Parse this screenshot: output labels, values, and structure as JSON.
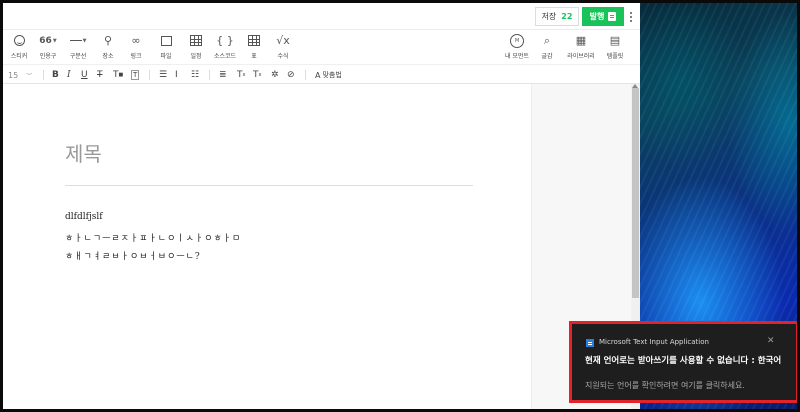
{
  "topbar": {
    "save_label": "저장",
    "save_count": "22",
    "publish_label": "발행"
  },
  "toolbar": {
    "items": [
      {
        "label": "스티커",
        "icon": "sticker-icon"
      },
      {
        "label": "인용구",
        "icon": "quote-icon",
        "glyph": "66"
      },
      {
        "label": "구분선",
        "icon": "divider-icon"
      },
      {
        "label": "장소",
        "icon": "place-icon",
        "glyph": "⚲"
      },
      {
        "label": "링크",
        "icon": "link-icon",
        "glyph": "∞"
      },
      {
        "label": "파일",
        "icon": "file-icon",
        "glyph": "+"
      },
      {
        "label": "일정",
        "icon": "schedule-icon"
      },
      {
        "label": "소스코드",
        "icon": "code-icon",
        "glyph": "{ }"
      },
      {
        "label": "표",
        "icon": "table-icon"
      },
      {
        "label": "수식",
        "icon": "formula-icon",
        "glyph": "√x"
      }
    ],
    "right_items": [
      {
        "label": "내 모먼트",
        "icon": "moment-icon",
        "glyph": "M"
      },
      {
        "label": "글감",
        "icon": "material-icon",
        "glyph": "⌕"
      },
      {
        "label": "라이브러리",
        "icon": "library-icon",
        "glyph": "▦"
      },
      {
        "label": "템플릿",
        "icon": "template-icon",
        "glyph": "▤"
      }
    ]
  },
  "formatbar": {
    "font_size": "15",
    "spell_check_label": "맞춤법"
  },
  "document": {
    "title_placeholder": "제목",
    "lines": [
      "dlfdlfjslf",
      "ㅎㅏㄴㄱㅡㄹㅈㅏㅍㅏㄴㅇㅣㅅㅏㅇㅎㅏㅁ",
      "ㅎㅐㄱㅕㄹㅂㅏㅇㅂㅓㅂㅇㅡㄴ?"
    ]
  },
  "toast": {
    "app_name": "Microsoft Text Input Application",
    "title": "현재 언어로는 받아쓰기를 사용할 수 없습니다 : 한국어",
    "body": "지원되는 언어를 확인하려면 여기를 클릭하세요.",
    "close_icon": "close-icon",
    "outline_color": "#e2232a"
  },
  "colors": {
    "accent": "#19c35a",
    "toast_bg": "#1e1e1e"
  }
}
